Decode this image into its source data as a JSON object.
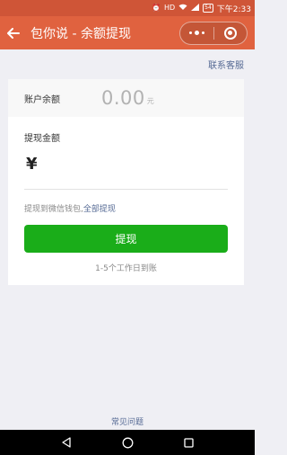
{
  "status_bar": {
    "time": "下午2:33",
    "battery": "54",
    "signal_label": "HD",
    "icons": [
      "alarm-icon",
      "hd-icon",
      "wifi-icon",
      "signal-icon",
      "battery-icon"
    ]
  },
  "nav": {
    "title": "包你说 - 余额提现",
    "back_icon": "arrow-left-icon",
    "more_icon": "more-dots-icon",
    "close_icon": "target-circle-icon"
  },
  "header": {
    "contact_service": "联系客服"
  },
  "balance": {
    "label": "账户余额",
    "value": "0.00",
    "unit": "元"
  },
  "withdraw": {
    "amount_label": "提现金额",
    "currency_symbol": "¥",
    "input_value": "",
    "hint_prefix": "提现到微信钱包,",
    "withdraw_all": "全部提现",
    "button_label": "提现",
    "arrival_note": "1-5个工作日到账"
  },
  "footer": {
    "faq": "常见问题"
  },
  "colors": {
    "nav_bg": "#e0623f",
    "status_bg": "#cf5537",
    "button_green": "#1aad19",
    "link_blue": "#576b95",
    "page_bg": "#efeff4"
  }
}
